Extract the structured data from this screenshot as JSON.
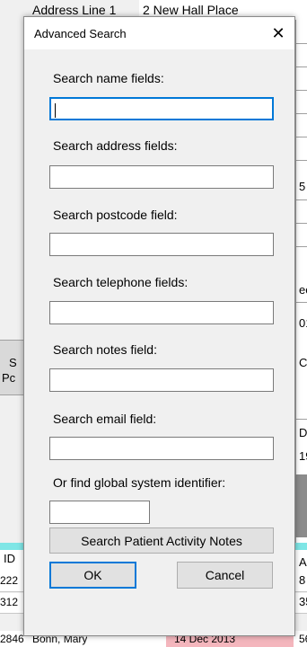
{
  "background": {
    "top_label": "Address Line 1",
    "top_value": "2 New Hall Place",
    "right_texts": [
      "5",
      "ec",
      "01",
      "C",
      "D",
      "19",
      "A",
      "8",
      "35",
      "56"
    ],
    "left_texts": [
      "S",
      "Pc"
    ],
    "table_header_id": "ID",
    "rows": [
      {
        "id": "222"
      },
      {
        "id": "312"
      }
    ],
    "last_row": {
      "id": "2846",
      "name": "Bonn, Mary",
      "date": "14 Dec 2013"
    }
  },
  "dialog": {
    "title": "Advanced Search",
    "close_glyph": "✕",
    "fields": [
      {
        "label": "Search name fields:",
        "value": ""
      },
      {
        "label": "Search address fields:",
        "value": ""
      },
      {
        "label": "Search postcode field:",
        "value": ""
      },
      {
        "label": "Search telephone fields:",
        "value": ""
      },
      {
        "label": "Search notes field:",
        "value": ""
      },
      {
        "label": "Search email field:",
        "value": ""
      }
    ],
    "global_id": {
      "label": "Or find global system identifier:",
      "value": ""
    },
    "activity_button": "Search Patient Activity Notes",
    "ok_button": "OK",
    "cancel_button": "Cancel"
  }
}
